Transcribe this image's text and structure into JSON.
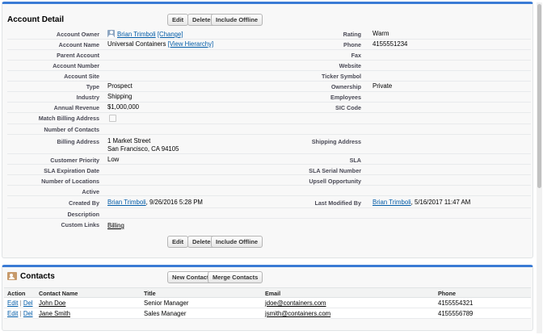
{
  "detail": {
    "title": "Account Detail",
    "buttons": {
      "edit": "Edit",
      "delete": "Delete",
      "include_offline": "Include Offline"
    },
    "owner": {
      "label": "Account Owner",
      "name": "Brian Trimboli",
      "change": "[Change]"
    },
    "account_name": {
      "label": "Account Name",
      "value": "Universal Containers",
      "hierarchy": "[View Hierarchy]"
    },
    "fields_left": {
      "parent_account": "Parent Account",
      "account_number": "Account Number",
      "account_site": "Account Site",
      "type": "Type",
      "industry": "Industry",
      "annual_revenue": "Annual Revenue",
      "match_billing": "Match Billing Address",
      "number_of_contacts": "Number of Contacts",
      "billing_address": "Billing Address",
      "customer_priority": "Customer Priority",
      "sla_expiration": "SLA Expiration Date",
      "number_of_locations": "Number of Locations",
      "active": "Active",
      "created_by": "Created By",
      "description": "Description",
      "custom_links": "Custom Links"
    },
    "values_left": {
      "type": "Prospect",
      "industry": "Shipping",
      "annual_revenue": "$1,000,000",
      "billing_line1": "1 Market Street",
      "billing_line2": "San Francisco, CA 94105",
      "customer_priority": "Low",
      "created_by_name": "Brian Trimboli",
      "created_by_date": ", 9/26/2016 5:28 PM",
      "custom_link": "Billing"
    },
    "fields_right": {
      "rating": "Rating",
      "phone": "Phone",
      "fax": "Fax",
      "website": "Website",
      "ticker": "Ticker Symbol",
      "ownership": "Ownership",
      "employees": "Employees",
      "sic": "SIC Code",
      "shipping_address": "Shipping Address",
      "sla": "SLA",
      "sla_serial": "SLA Serial Number",
      "upsell": "Upsell Opportunity",
      "last_modified": "Last Modified By"
    },
    "values_right": {
      "rating": "Warm",
      "phone": "4155551234",
      "ownership": "Private",
      "modified_by_name": "Brian Trimboli",
      "modified_by_date": ", 5/16/2017 11:47 AM"
    }
  },
  "contacts": {
    "title": "Contacts",
    "new_contact": "New Contact",
    "merge_contacts": "Merge Contacts",
    "columns": [
      "Action",
      "Contact Name",
      "Title",
      "Email",
      "Phone"
    ],
    "action_edit": "Edit",
    "action_sep": "|",
    "action_del": "Del",
    "rows": [
      {
        "name": "John Doe",
        "title": "Senior Manager",
        "email": "jdoe@containers.com",
        "phone": "4155554321"
      },
      {
        "name": "Jane Smith",
        "title": "Sales Manager",
        "email": "jsmith@containers.com",
        "phone": "4155556789"
      }
    ]
  }
}
